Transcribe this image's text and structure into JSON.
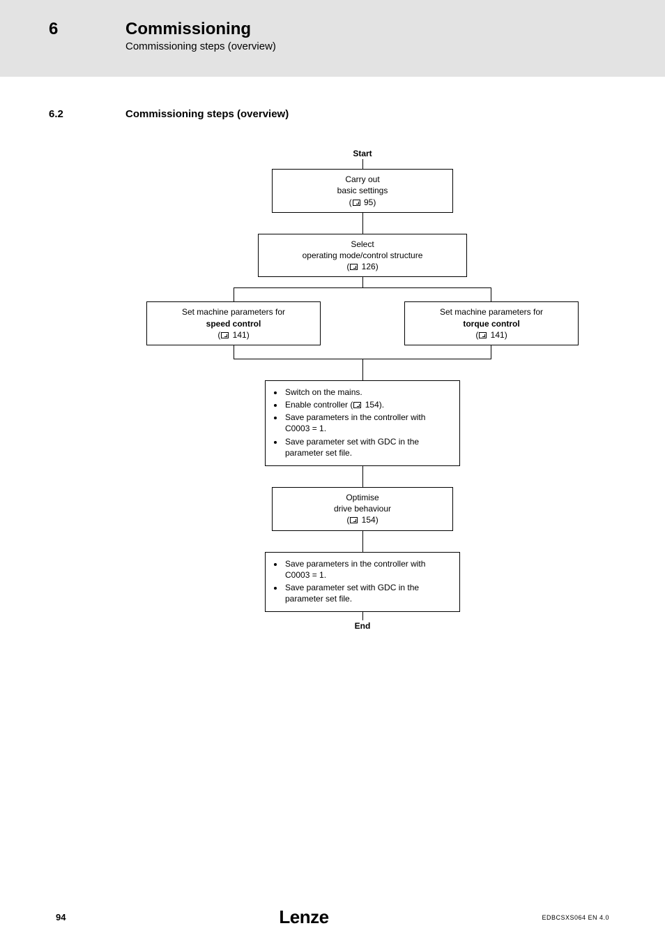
{
  "header": {
    "chapter_number": "6",
    "chapter_title": "Commissioning",
    "chapter_subtitle": "Commissioning steps (overview)"
  },
  "section": {
    "number": "6.2",
    "title": "Commissioning steps (overview)"
  },
  "flow": {
    "start": "Start",
    "end": "End",
    "box_basic_l1": "Carry out",
    "box_basic_l2": "basic settings",
    "box_basic_ref": "95",
    "box_select_l1": "Select",
    "box_select_l2": "operating mode/control structure",
    "box_select_ref": "126",
    "left_l1": "Set machine parameters for",
    "left_l2": "speed control",
    "left_ref": "141",
    "right_l1": "Set machine parameters for",
    "right_l2": "torque control",
    "right_ref": "141",
    "switch_b1": "Switch on the mains.",
    "switch_b2a": "Enable controller (",
    "switch_b2_ref": "154",
    "switch_b2b": ").",
    "switch_b3": "Save parameters in the controller with C0003 = 1.",
    "switch_b4": "Save parameter set with GDC in the parameter set file.",
    "opt_l1": "Optimise",
    "opt_l2": "drive behaviour",
    "opt_ref": "154",
    "save2_b1": "Save parameters in the controller with C0003 = 1.",
    "save2_b2": "Save parameter set with GDC in the parameter set file."
  },
  "footer": {
    "page": "94",
    "brand": "Lenze",
    "doc_id": "EDBCSXS064 EN 4.0"
  }
}
